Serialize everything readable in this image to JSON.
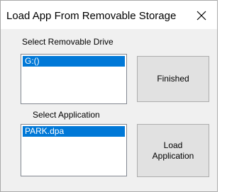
{
  "window": {
    "title": "Load App From Removable Storage",
    "close_icon": "close-icon"
  },
  "drive_section": {
    "label": "Select Removable Drive",
    "items": [
      "G:()"
    ],
    "selected_index": 0
  },
  "application_section": {
    "label": "Select Application",
    "items": [
      "PARK.dpa"
    ],
    "selected_index": 0
  },
  "buttons": {
    "finished_label": "Finished",
    "load_line1": "Load",
    "load_line2": "Application"
  },
  "colors": {
    "selection": "#0078d7",
    "button_face": "#e1e1e1",
    "dialog_bg": "#f0f0f0"
  }
}
